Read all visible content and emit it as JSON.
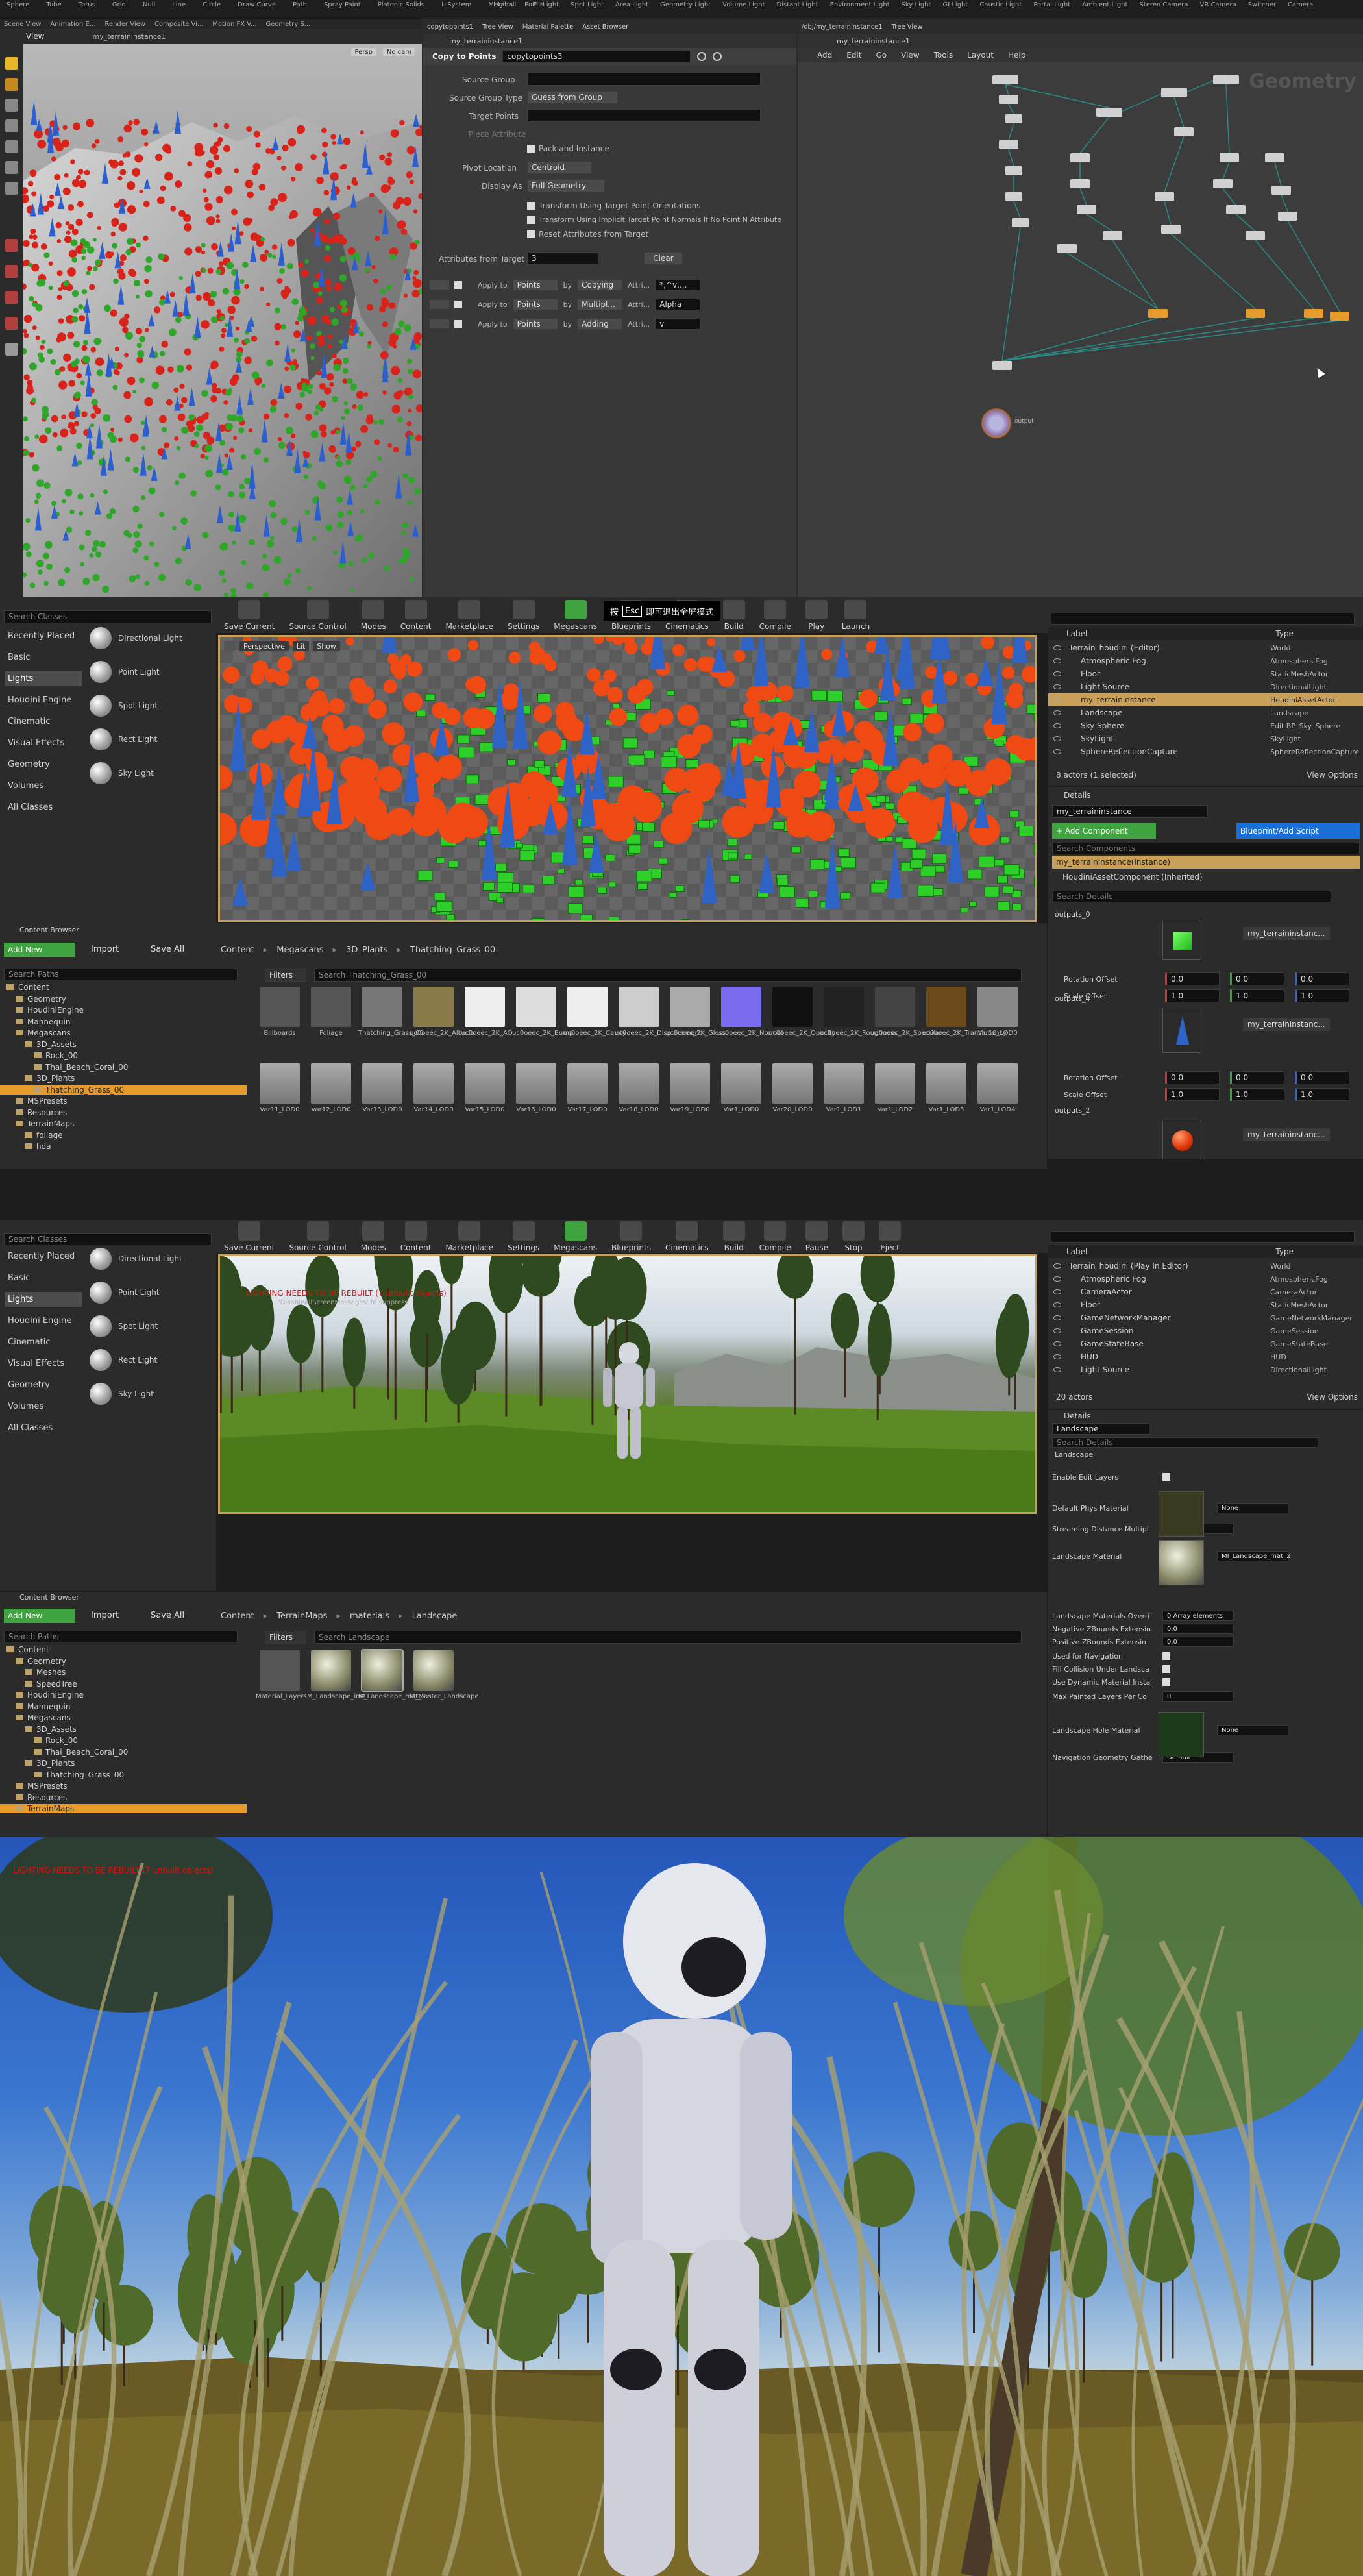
{
  "houdini": {
    "top_menu": [
      "Scene View",
      "Animation E...",
      "Render View",
      "Composite Vi...",
      "Motion FX V...",
      "Geometry S..."
    ],
    "shelf_tools": [
      "Sphere",
      "Tube",
      "Torus",
      "Grid",
      "Null",
      "Line",
      "Circle",
      "Draw Curve",
      "Path",
      "Spray Paint",
      "Platonic Solids",
      "L-System",
      "Metaball",
      "File"
    ],
    "light_tools": [
      "Lights",
      "Point Light",
      "Spot Light",
      "Area Light",
      "Geometry Light",
      "Volume Light",
      "Distant Light",
      "Environment Light",
      "Sky Light",
      "GI Light",
      "Caustic Light",
      "Portal Light",
      "Ambient Light",
      "Stereo Camera",
      "VR Camera",
      "Switcher",
      "Camera"
    ],
    "viewport_tab": "View",
    "viewport_path": "my_terraininstance1",
    "viewport_persp": "Persp",
    "viewport_cam": "No cam",
    "param_tabs": [
      "copytopoints1",
      "Tree View",
      "Material Palette",
      "Asset Browser"
    ],
    "param_path": "my_terraininstance1",
    "param_node_type": "Copy to Points",
    "param_node_name": "copytopoints3",
    "params": {
      "source_group_label": "Source Group",
      "source_group_type_label": "Source Group Type",
      "source_group_type_value": "Guess from Group",
      "target_points_label": "Target Points",
      "piece_attribute_label": "Piece Attribute",
      "pack_instance_label": "Pack and Instance",
      "pivot_location_label": "Pivot Location",
      "pivot_location_value": "Centroid",
      "display_as_label": "Display As",
      "display_as_value": "Full Geometry",
      "transform_target_label": "Transform Using Target Point Orientations",
      "transform_implicit_label": "Transform Using Implicit Target Point Normals If No Point N Attribute",
      "reset_attr_label": "Reset Attributes from Target",
      "attrs_from_target_label": "Attributes from Target",
      "attrs_from_target_value": "3",
      "clear_label": "Clear",
      "apply_rows": [
        {
          "apply_to": "Points",
          "by": "Copying",
          "attrib": "*,^v,..."
        },
        {
          "apply_to": "Points",
          "by": "Multipl...",
          "attrib": "Alpha"
        },
        {
          "apply_to": "Points",
          "by": "Adding",
          "attrib": "v"
        }
      ],
      "apply_to_label": "Apply to",
      "by_label": "by",
      "attrib_label": "Attri..."
    },
    "net_tabs": [
      "/obj/my_terraininstance1",
      "Tree View"
    ],
    "net_path": "my_terraininstance1",
    "net_menu": [
      "Add",
      "Edit",
      "Go",
      "View",
      "Tools",
      "Layout",
      "Help"
    ],
    "net_watermark": "Geometry",
    "output_node_label": "output"
  },
  "ue1": {
    "toolbar": [
      "Save Current",
      "Source Control",
      "Modes",
      "Content",
      "Marketplace",
      "Settings",
      "Megascans",
      "Blueprints",
      "Cinematics",
      "Build",
      "Compile",
      "Play",
      "Launch"
    ],
    "esc_hint_key": "按",
    "esc_hint_esc": "Esc",
    "esc_hint_text": "即可退出全屏模式",
    "place_search": "Search Classes",
    "place_categories": [
      "Recently Placed",
      "Basic",
      "Lights",
      "Houdini Engine",
      "Cinematic",
      "Visual Effects",
      "Geometry",
      "Volumes",
      "All Classes"
    ],
    "place_selected": "Lights",
    "place_items": [
      "Directional Light",
      "Point Light",
      "Spot Light",
      "Rect Light",
      "Sky Light"
    ],
    "viewport_buttons": [
      "Perspective",
      "Lit",
      "Show"
    ],
    "outliner_headers": [
      "Label",
      "Type"
    ],
    "outliner_rows": [
      {
        "label": "Terrain_houdini (Editor)",
        "type": "World"
      },
      {
        "label": "Atmospheric Fog",
        "type": "AtmosphericFog"
      },
      {
        "label": "Floor",
        "type": "StaticMeshActor"
      },
      {
        "label": "Light Source",
        "type": "DirectionalLight"
      },
      {
        "label": "my_terraininstance",
        "type": "HoudiniAssetActor"
      },
      {
        "label": "Landscape",
        "type": "Landscape"
      },
      {
        "label": "Sky Sphere",
        "type": "Edit BP_Sky_Sphere"
      },
      {
        "label": "SkyLight",
        "type": "SkyLight"
      },
      {
        "label": "SphereReflectionCapture",
        "type": "SphereReflectionCapture"
      }
    ],
    "outliner_status": "8 actors (1 selected)",
    "view_options": "View Options",
    "details_tab": "Details",
    "details_name": "my_terraininstance",
    "add_component": "+ Add Component",
    "blueprint_script": "Blueprint/Add Script",
    "search_components": "Search Components",
    "component_root": "my_terraininstance(Instance)",
    "component_child": "HoudiniAssetComponent (Inherited)",
    "search_details": "Search Details",
    "outputs": [
      "outputs_0",
      "outputs_4",
      "outputs_2"
    ],
    "material_name": "my_terraininstanc...",
    "rotation_offset": "Rotation Offset",
    "scale_offset": "Scale Offset",
    "rot_vals": [
      "0.0",
      "0.0",
      "0.0"
    ],
    "scale_vals": [
      "1.0",
      "1.0",
      "1.0"
    ],
    "content_browser_tab": "Content Browser",
    "add_new": "Add New",
    "import": "Import",
    "save_all": "Save All",
    "breadcrumb": [
      "Content",
      "Megascans",
      "3D_Plants",
      "Thatching_Grass_00"
    ],
    "search_paths": "Search Paths",
    "filters": "Filters",
    "search_assets": "Search Thatching_Grass_00",
    "tree": [
      "Content",
      "Geometry",
      "HoudiniEngine",
      "Mannequin",
      "Megascans",
      "3D_Assets",
      "Rock_00",
      "Thai_Beach_Coral_00",
      "3D_Plants",
      "Thatching_Grass_00",
      "MSPresets",
      "Resources",
      "TerrainMaps",
      "foliage",
      "hda"
    ],
    "tree_selected": "Thatching_Grass_00",
    "asset_row1": [
      "Billboards",
      "Foliage",
      "Thatching_Grass_00",
      "uc0oeec_2K_Albedo",
      "uc0oeec_2K_AO",
      "uc0oeec_2K_Bump",
      "uc0oeec_2K_Cavity",
      "uc0oeec_2K_Displacement",
      "uc0oeec_2K_Gloss",
      "uc0oeec_2K_Normal",
      "uc0oeec_2K_Opacity",
      "uc0oeec_2K_Roughness",
      "uc0oeec_2K_Specular",
      "uc0oeec_2K_Translucency",
      "Var10_LOD0"
    ],
    "asset_row2": [
      "Var11_LOD0",
      "Var12_LOD0",
      "Var13_LOD0",
      "Var14_LOD0",
      "Var15_LOD0",
      "Var16_LOD0",
      "Var17_LOD0",
      "Var18_LOD0",
      "Var19_LOD0",
      "Var1_LOD0",
      "Var20_LOD0",
      "Var1_LOD1",
      "Var1_LOD2",
      "Var1_LOD3",
      "Var1_LOD4"
    ]
  },
  "ue2": {
    "toolbar": [
      "Save Current",
      "Source Control",
      "Modes",
      "Content",
      "Marketplace",
      "Settings",
      "Megascans",
      "Blueprints",
      "Cinematics",
      "Build",
      "Compile",
      "Pause",
      "Stop",
      "Eject"
    ],
    "place_search": "Search Classes",
    "place_categories": [
      "Recently Placed",
      "Basic",
      "Lights",
      "Houdini Engine",
      "Cinematic",
      "Visual Effects",
      "Geometry",
      "Volumes",
      "All Classes"
    ],
    "place_selected": "Lights",
    "place_items": [
      "Directional Light",
      "Point Light",
      "Spot Light",
      "Rect Light",
      "Sky Light"
    ],
    "warning_text": "LIGHTING NEEDS TO BE REBUILT (7 unbuilt objects)",
    "warning_sub": "'DisableAllScreenMessages' to suppress",
    "outliner_headers": [
      "Label",
      "Type"
    ],
    "outliner_rows": [
      {
        "label": "Terrain_houdini (Play In Editor)",
        "type": "World"
      },
      {
        "label": "Atmospheric Fog",
        "type": "AtmosphericFog"
      },
      {
        "label": "CameraActor",
        "type": "CameraActor"
      },
      {
        "label": "Floor",
        "type": "StaticMeshActor"
      },
      {
        "label": "GameNetworkManager",
        "type": "GameNetworkManager"
      },
      {
        "label": "GameSession",
        "type": "GameSession"
      },
      {
        "label": "GameStateBase",
        "type": "GameStateBase"
      },
      {
        "label": "HUD",
        "type": "HUD"
      },
      {
        "label": "Light Source",
        "type": "DirectionalLight"
      }
    ],
    "outliner_status": "20 actors",
    "view_options": "View Options",
    "details_tab": "Details",
    "details_name": "Landscape",
    "search_details": "Search Details",
    "section": "Landscape",
    "props": [
      {
        "label": "Enable Edit Layers",
        "value": ""
      },
      {
        "label": "Default Phys Material",
        "value": "None"
      },
      {
        "label": "Streaming Distance Multipl",
        "value": "1.0"
      },
      {
        "label": "Landscape Material",
        "value": "MI_Landscape_mat_2"
      },
      {
        "label": "Landscape Materials Overri",
        "value": "0 Array elements"
      },
      {
        "label": "Negative ZBounds Extensio",
        "value": "0.0"
      },
      {
        "label": "Positive ZBounds Extensio",
        "value": "0.0"
      },
      {
        "label": "Used for Navigation",
        "value": ""
      },
      {
        "label": "Fill Collision Under Landsca",
        "value": ""
      },
      {
        "label": "Use Dynamic Material Insta",
        "value": ""
      },
      {
        "label": "Max Painted Layers Per Co",
        "value": "0"
      },
      {
        "label": "Landscape Hole Material",
        "value": "None"
      },
      {
        "label": "Navigation Geometry Gathe",
        "value": "Default"
      }
    ],
    "content_browser_tab": "Content Browser",
    "add_new": "Add New",
    "import": "Import",
    "save_all": "Save All",
    "breadcrumb": [
      "Content",
      "TerrainMaps",
      "materials",
      "Landscape"
    ],
    "search_paths": "Search Paths",
    "filters": "Filters",
    "search_assets": "Search Landscape",
    "tree": [
      "Content",
      "Geometry",
      "Meshes",
      "SpeedTree",
      "HoudiniEngine",
      "Mannequin",
      "Megascans",
      "3D_Assets",
      "Rock_00",
      "Thai_Beach_Coral_00",
      "3D_Plants",
      "Thatching_Grass_00",
      "MSPresets",
      "Resources",
      "TerrainMaps"
    ],
    "tree_selected": "TerrainMaps",
    "assets": [
      "Material_Layers",
      "M_Landscape_inst",
      "M_Landscape_mat_2",
      "M_Master_Landscape"
    ]
  },
  "game": {
    "warning_text": "LIGHTING NEEDS TO BE REBUILT (7 unbuilt objects)"
  },
  "colors": {
    "accent_orange": "#e79b2a",
    "selection_orange": "#c9a05a",
    "ue_green": "#3fa33f",
    "ue_blue": "#1a6ed8",
    "warning_red": "#e01010"
  }
}
